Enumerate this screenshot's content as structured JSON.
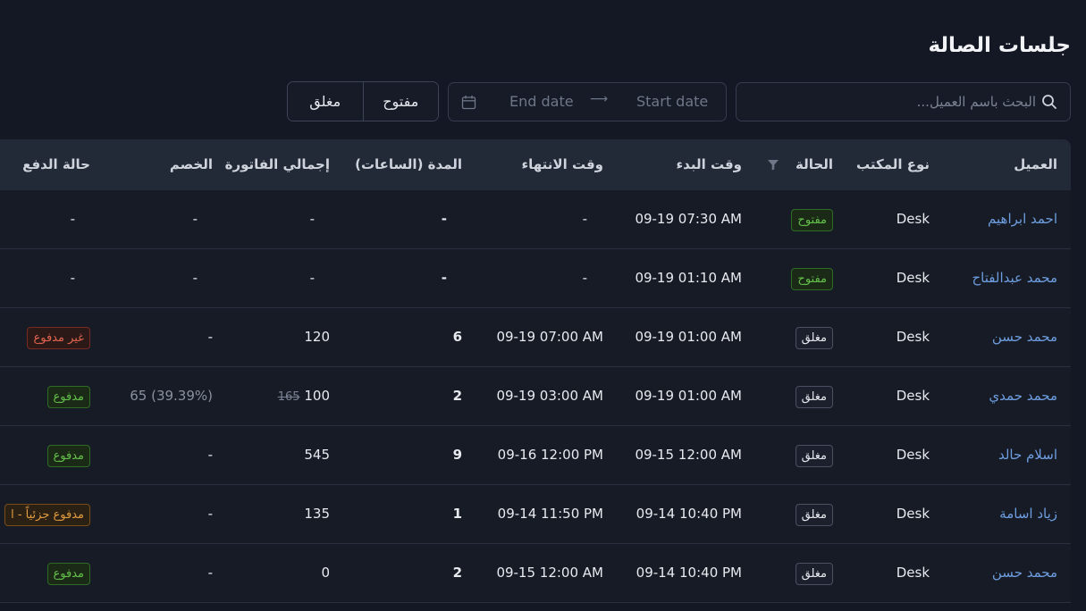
{
  "page": {
    "title": "جلسات الصالة"
  },
  "filters": {
    "search_placeholder": "البحث باسم العميل...",
    "date_start_placeholder": "Start date",
    "date_end_placeholder": "End date",
    "status_open": "مفتوح",
    "status_closed": "مغلق"
  },
  "table": {
    "headers": {
      "client": "العميل",
      "desk_type": "نوع المكتب",
      "status": "الحالة",
      "start_time": "وقت البدء",
      "end_time": "وقت الانتهاء",
      "duration": "المدة (الساعات)",
      "invoice_total": "إجمالي الفاتورة",
      "discount": "الخصم",
      "payment_status": "حالة الدفع"
    },
    "rows": [
      {
        "client": "احمد ابراهيم",
        "desk": "Desk",
        "status": "مفتوح",
        "start": "09-19 07:30 AM",
        "end": "-",
        "duration": "-",
        "total": "-",
        "total_old": "",
        "discount": "-",
        "payment": "-"
      },
      {
        "client": "محمد عبدالفتاح",
        "desk": "Desk",
        "status": "مفتوح",
        "start": "09-19 01:10 AM",
        "end": "-",
        "duration": "-",
        "total": "-",
        "total_old": "",
        "discount": "-",
        "payment": "-"
      },
      {
        "client": "محمد حسن",
        "desk": "Desk",
        "status": "مغلق",
        "start": "09-19 01:00 AM",
        "end": "09-19 07:00 AM",
        "duration": "6",
        "total": "120",
        "total_old": "",
        "discount": "-",
        "payment": "غير مدفوع"
      },
      {
        "client": "محمد حمدي",
        "desk": "Desk",
        "status": "مغلق",
        "start": "09-19 01:00 AM",
        "end": "09-19 03:00 AM",
        "duration": "2",
        "total": "100",
        "total_old": "165",
        "discount": "65 (39.39%)",
        "payment": "مدفوع"
      },
      {
        "client": "اسلام حالد",
        "desk": "Desk",
        "status": "مغلق",
        "start": "09-15 12:00 AM",
        "end": "09-16 12:00 PM",
        "duration": "9",
        "total": "545",
        "total_old": "",
        "discount": "-",
        "payment": "مدفوع"
      },
      {
        "client": "زياد اسامة",
        "desk": "Desk",
        "status": "مغلق",
        "start": "09-14 10:40 PM",
        "end": "09-14 11:50 PM",
        "duration": "1",
        "total": "135",
        "total_old": "",
        "discount": "-",
        "payment": "مدفوع جزئياً - ا"
      },
      {
        "client": "محمد حسن",
        "desk": "Desk",
        "status": "مغلق",
        "start": "09-14 10:40 PM",
        "end": "09-15 12:00 AM",
        "duration": "2",
        "total": "0",
        "total_old": "",
        "discount": "-",
        "payment": "مدفوع"
      }
    ]
  },
  "colors": {
    "background": "#141824",
    "header_bg": "#222a38",
    "link": "#6e9ee0",
    "open": "#63c04a",
    "unpaid": "#e2644f",
    "partial": "#e09a3f"
  },
  "icons": {
    "search": "search-icon",
    "calendar": "calendar-icon",
    "arrow": "arrow-right-icon",
    "filter": "filter-icon"
  }
}
